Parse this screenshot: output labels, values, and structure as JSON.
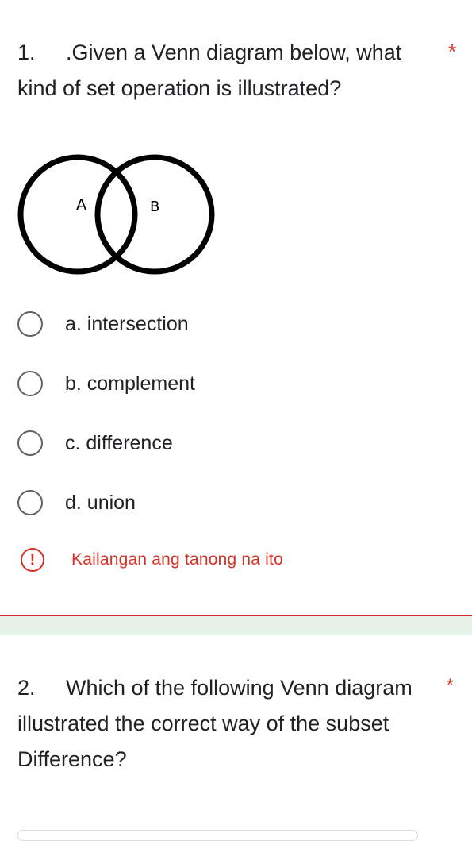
{
  "question1": {
    "number": "1.",
    "text": ".Given a Venn diagram below, what kind of set operation is illustrated?",
    "required_mark": "*",
    "diagram": {
      "label_a": "A",
      "label_b": "B"
    },
    "options": [
      {
        "label": "a. intersection"
      },
      {
        "label": "b. complement"
      },
      {
        "label": "c. difference"
      },
      {
        "label": "d. union"
      }
    ],
    "error_icon": "!",
    "error_text": "Kailangan ang tanong na ito"
  },
  "question2": {
    "number": "2.",
    "text": "Which of the following Venn diagram illustrated the correct way of the subset Difference?",
    "required_mark": "*"
  },
  "colors": {
    "error": "#d93025",
    "section_gap": "#e6f2e8",
    "radio_border": "#5f6368"
  },
  "icons": {
    "radio": "radio-unchecked-icon",
    "error": "exclamation-circle-icon"
  }
}
